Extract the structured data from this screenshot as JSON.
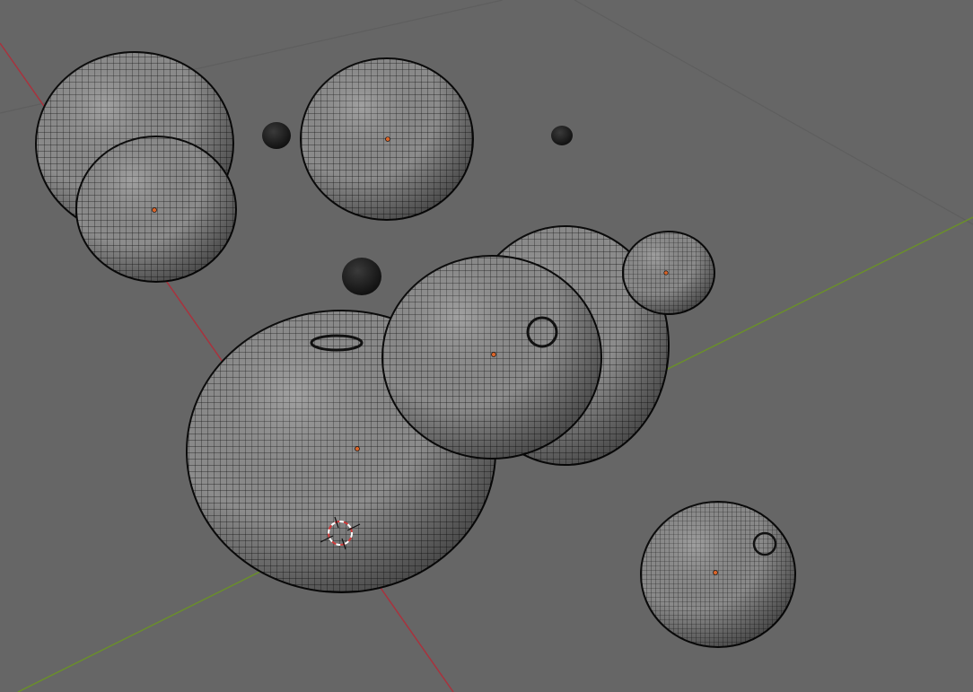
{
  "viewport": {
    "background_color": "#666666",
    "grid_line_color": "#5e5e5e",
    "x_axis_color": "#a8323d",
    "y_axis_color": "#6a8f2a",
    "mesh_fill_color": "#8c8c8c",
    "mesh_wire_color": "#141414",
    "origin_dot_color": "#d9652a",
    "cursor_color_a": "#d23a3a",
    "cursor_color_b": "#ffffff",
    "object_count": 11,
    "cursor_icon": "3d-cursor-icon"
  }
}
